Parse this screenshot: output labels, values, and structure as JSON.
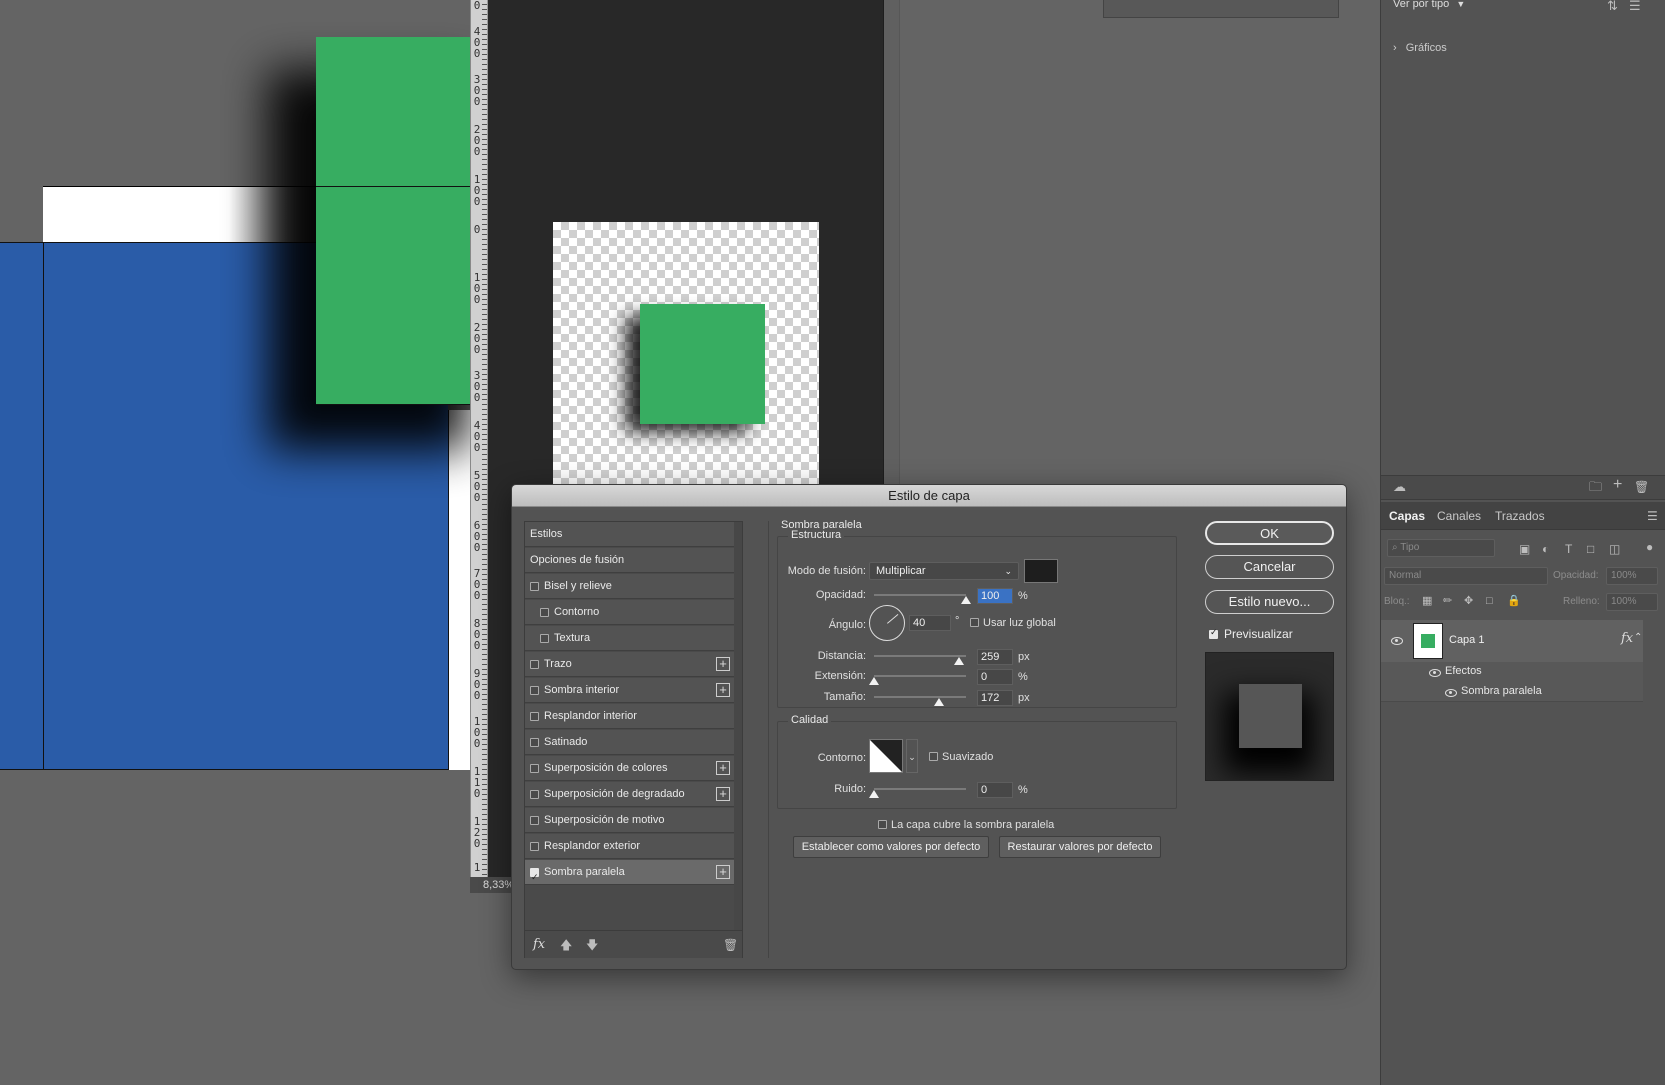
{
  "canvas": {
    "ruler_labels": [
      "0",
      "4\n0\n0",
      "3\n0\n0",
      "2\n0\n0",
      "1\n0\n0",
      "0",
      "1\n0\n0",
      "2\n0\n0",
      "3\n0\n0",
      "4\n0\n0",
      "5\n0\n0",
      "6\n0\n0",
      "7\n0\n0",
      "8\n0\n0",
      "9\n0\n0",
      "1\n0\n0",
      "1\n1\n0",
      "1\n2\n0",
      "1"
    ],
    "zoom": "8,33%",
    "colors": {
      "blue": "#2a5ca8",
      "green": "#37ad61",
      "workspace": "#646464"
    }
  },
  "panel": {
    "filter_label": "Ver por tipo",
    "graficos": "Gráficos",
    "tabs": [
      "Capas",
      "Canales",
      "Trazados"
    ],
    "search_placeholder": "Tipo",
    "blend_mode": "Normal",
    "opacity_label": "Opacidad:",
    "opacity_value": "100%",
    "lock_label": "Bloq.:",
    "fill_label": "Relleno:",
    "fill_value": "100%",
    "layer_name": "Capa 1",
    "fx_label": "fx",
    "effects_label": "Efectos",
    "effect_name": "Sombra paralela"
  },
  "dialog": {
    "title": "Estilo de capa",
    "styles": [
      {
        "label": "Estilos",
        "type": "header"
      },
      {
        "label": "Opciones de fusión",
        "type": "header"
      },
      {
        "label": "Bisel y relieve",
        "checked": false,
        "plus": false,
        "indent": false
      },
      {
        "label": "Contorno",
        "checked": false,
        "plus": false,
        "indent": true
      },
      {
        "label": "Textura",
        "checked": false,
        "plus": false,
        "indent": true
      },
      {
        "label": "Trazo",
        "checked": false,
        "plus": true,
        "indent": false
      },
      {
        "label": "Sombra interior",
        "checked": false,
        "plus": true,
        "indent": false
      },
      {
        "label": "Resplandor interior",
        "checked": false,
        "plus": false,
        "indent": false
      },
      {
        "label": "Satinado",
        "checked": false,
        "plus": false,
        "indent": false
      },
      {
        "label": "Superposición de colores",
        "checked": false,
        "plus": true,
        "indent": false
      },
      {
        "label": "Superposición de degradado",
        "checked": false,
        "plus": true,
        "indent": false
      },
      {
        "label": "Superposición de motivo",
        "checked": false,
        "plus": false,
        "indent": false
      },
      {
        "label": "Resplandor exterior",
        "checked": false,
        "plus": false,
        "indent": false
      },
      {
        "label": "Sombra paralela",
        "checked": true,
        "plus": true,
        "indent": false,
        "selected": true
      }
    ],
    "fx_label": "fx",
    "section_title": "Sombra paralela",
    "structure_title": "Estructura",
    "blend_label": "Modo de fusión:",
    "blend_value": "Multiplicar",
    "shadow_color": "#1e1e1e",
    "opacity_label": "Opacidad:",
    "opacity_value": "100",
    "opacity_percent": 100,
    "percent": "%",
    "angle_label": "Ángulo:",
    "angle_value": "40",
    "degree": "°",
    "global_light_label": "Usar luz global",
    "distance_label": "Distancia:",
    "distance_value": "259",
    "distance_percent": 92,
    "spread_label": "Extensión:",
    "spread_value": "0",
    "spread_percent": 0,
    "size_label": "Tamaño:",
    "size_value": "172",
    "size_percent": 71,
    "px": "px",
    "quality_title": "Calidad",
    "contour_label": "Contorno:",
    "antialias_label": "Suavizado",
    "noise_label": "Ruido:",
    "noise_value": "0",
    "noise_percent": 0,
    "knockout_label": "La capa cubre la sombra paralela",
    "make_default": "Establecer como valores por defecto",
    "reset_default": "Restaurar valores por defecto",
    "ok": "OK",
    "cancel": "Cancelar",
    "new_style": "Estilo nuevo...",
    "preview_label": "Previsualizar"
  }
}
